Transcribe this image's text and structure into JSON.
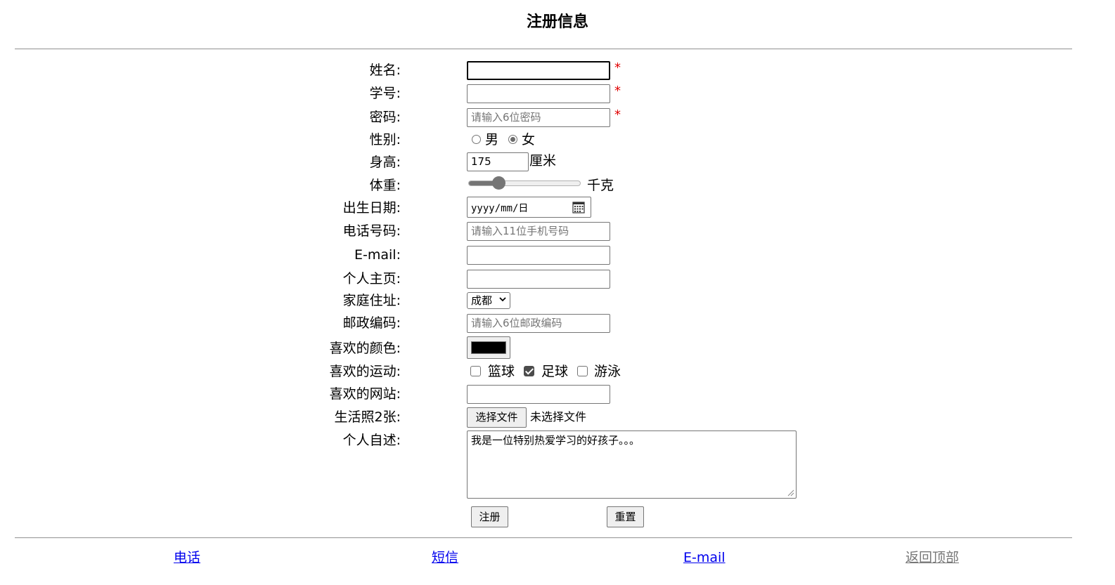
{
  "page_title": "注册信息",
  "form": {
    "name": {
      "label": "姓名:",
      "value": "",
      "required_mark": "*"
    },
    "student_id": {
      "label": "学号:",
      "value": "",
      "required_mark": "*"
    },
    "password": {
      "label": "密码:",
      "placeholder": "请输入6位密码",
      "required_mark": "*"
    },
    "gender": {
      "label": "性别:",
      "options": [
        "男",
        "女"
      ],
      "selected": "女"
    },
    "height": {
      "label": "身高:",
      "value": "175",
      "unit": "厘米"
    },
    "weight": {
      "label": "体重:",
      "unit": "千克",
      "slider_fraction": 0.27
    },
    "birthdate": {
      "label": "出生日期:",
      "placeholder": "yyyy/mm/日"
    },
    "phone": {
      "label": "电话号码:",
      "placeholder": "请输入11位手机号码"
    },
    "email": {
      "label": "E-mail:",
      "value": ""
    },
    "homepage": {
      "label": "个人主页:",
      "value": ""
    },
    "address": {
      "label": "家庭住址:",
      "selected": "成都"
    },
    "postcode": {
      "label": "邮政编码:",
      "placeholder": "请输入6位邮政编码"
    },
    "color": {
      "label": "喜欢的颜色:",
      "value": "#000000"
    },
    "sports": {
      "label": "喜欢的运动:",
      "options": [
        {
          "label": "篮球",
          "checked": false
        },
        {
          "label": "足球",
          "checked": true
        },
        {
          "label": "游泳",
          "checked": false
        }
      ]
    },
    "website": {
      "label": "喜欢的网站:",
      "value": ""
    },
    "photos": {
      "label": "生活照2张:",
      "button": "选择文件",
      "status": "未选择文件"
    },
    "bio": {
      "label": "个人自述:",
      "value": "我是一位特别热爱学习的好孩子。。。"
    },
    "submit_label": "注册",
    "reset_label": "重置"
  },
  "footer": {
    "phone": "电话",
    "sms": "短信",
    "email": "E-mail",
    "back_to_top": "返回顶部"
  }
}
